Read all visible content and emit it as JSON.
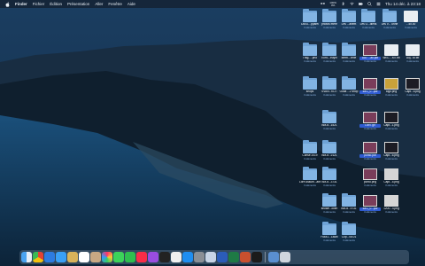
{
  "menubar": {
    "app_name": "Finder",
    "menus": [
      "Fichier",
      "Édition",
      "Présentation",
      "Aller",
      "Fenêtre",
      "Aide"
    ],
    "status_top": "100%",
    "status_bottom": "0%",
    "clock": "Thu 14 déc. à 23:18"
  },
  "desktop": {
    "row1": [
      {
        "label": "Docu....pparel",
        "sub": "3 éléments"
      },
      {
        "label": "photos mere",
        "sub": "3 éléments"
      },
      {
        "label": "Les ...ahem",
        "sub": "3 éléments"
      },
      {
        "label": "Les O...diens",
        "sub": "3 éléments"
      },
      {
        "label": "Les V... unne",
        "sub": "3 éléments"
      },
      {
        "label": "...40.00",
        "sub": "3 éléments"
      }
    ],
    "row2": [
      {
        "label": "Trag.....pho",
        "sub": "3 éléments"
      },
      {
        "label": "Écrit....euyin",
        "sub": "3 éléments"
      },
      {
        "label": "Mem....texe",
        "sub": "3 éléments"
      },
      {
        "label": "DAT ...ax.pdf",
        "sub": "3 éléments"
      },
      {
        "label": "WEL....M7.txt",
        "sub": "3 éléments"
      },
      {
        "label": "Auj...M.txt",
        "sub": "3 éléments"
      }
    ],
    "row3": [
      {
        "label": "shops",
        "sub": "3 éléments"
      },
      {
        "label": "SVAN...KLIT",
        "sub": "3 éléments"
      },
      {
        "label": "Outla ...2 shop",
        "sub": "3 éléments"
      },
      {
        "label": "IMG_0...pdf",
        "sub": "3 éléments"
      },
      {
        "label": "logo.png",
        "sub": "3 éléments"
      },
      {
        "label": "Capt...5.png",
        "sub": "3 éléments"
      }
    ],
    "row4": [
      {
        "label": "BM-d...1521",
        "sub": "3 éléments"
      },
      {
        "label": "DWT.gif",
        "sub": "3 éléments"
      },
      {
        "label": "Capt...1.png",
        "sub": "3 éléments"
      }
    ],
    "row5": [
      {
        "label": "Conse 2019",
        "sub": "3 éléments"
      },
      {
        "label": "BM-d...2121",
        "sub": "3 éléments"
      },
      {
        "label": "ponto.pdf",
        "sub": "3 éléments"
      },
      {
        "label": "Capt...6.png",
        "sub": "3 éléments"
      }
    ],
    "row6": [
      {
        "label": "Lore Assum...ahem",
        "sub": "3 éléments"
      },
      {
        "label": "BM-d...3731",
        "sub": "3 éléments"
      },
      {
        "label": "ponto.png",
        "sub": "3 éléments"
      },
      {
        "label": "Capt...5.png",
        "sub": "3 éléments"
      }
    ],
    "row7": [
      {
        "label": "showe...ollen",
        "sub": "3 éléments"
      },
      {
        "label": "BM-d...9731",
        "sub": "3 éléments"
      },
      {
        "label": "IMG_0...pdf",
        "sub": "3 éléments"
      },
      {
        "label": "1200...4.png",
        "sub": "3 éléments"
      }
    ],
    "row8": [
      {
        "label": "Fuk41...18lan",
        "sub": "3 éléments"
      },
      {
        "label": "Cop...08.01",
        "sub": "3 éléments"
      }
    ]
  },
  "dock": {
    "apps": [
      "finder",
      "chrome",
      "safari",
      "mail",
      "notes",
      "calendar",
      "contacts",
      "photos",
      "messages",
      "facetime",
      "music",
      "podcasts",
      "tv",
      "news",
      "appstore",
      "settings",
      "preview",
      "word",
      "excel",
      "powerpoint",
      "terminal",
      "downloads",
      "trash"
    ]
  }
}
